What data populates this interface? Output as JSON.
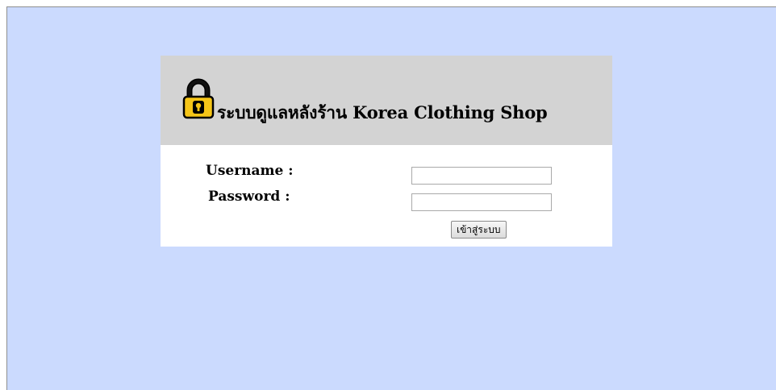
{
  "header": {
    "title": "ระบบดูแลหลังร้าน Korea Clothing Shop",
    "icon": "lock-icon"
  },
  "form": {
    "username_label": "Username :",
    "username_value": "",
    "password_label": "Password :",
    "password_value": "",
    "submit_label": "เข้าสู่ระบบ"
  },
  "colors": {
    "page_background": "#cbdafe",
    "header_background": "#d3d3d3",
    "panel_background": "#ffffff",
    "lock_body": "#f5c518"
  }
}
